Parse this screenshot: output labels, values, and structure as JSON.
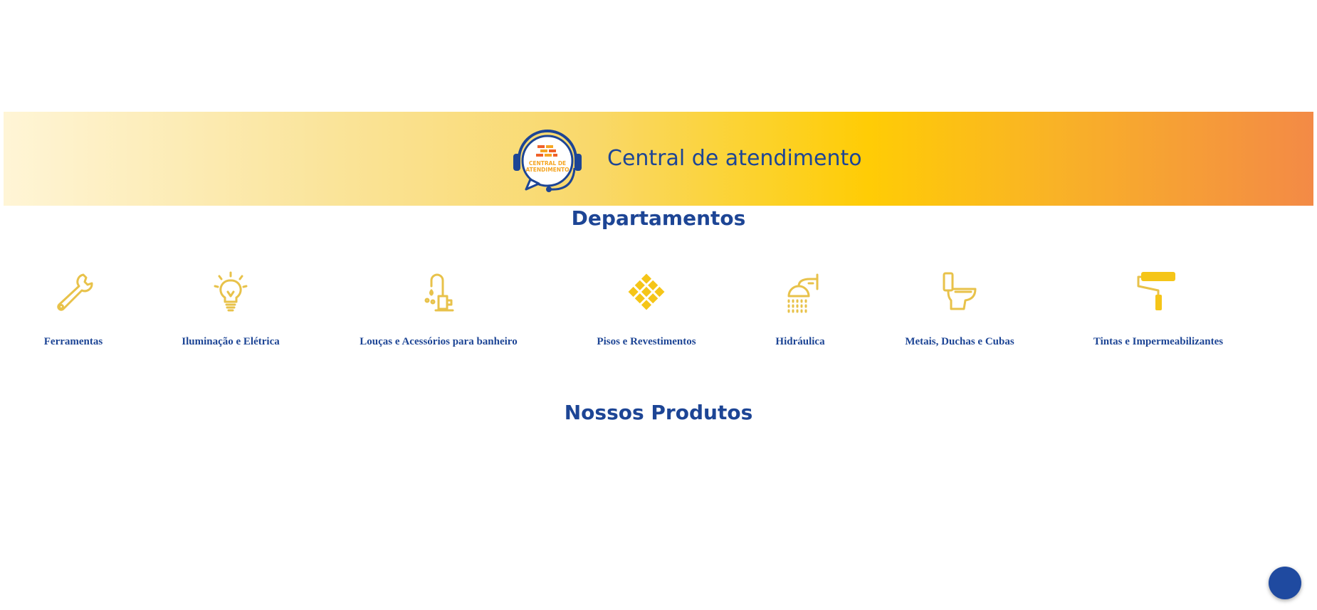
{
  "banner": {
    "title": "Central de atendimento",
    "logo_text_line1": "CENTRAL DE",
    "logo_text_line2": "ATENDIMENTO",
    "gradient_colors": [
      "#fff5d6",
      "#fcd22a",
      "#ffcc05",
      "#f38a46"
    ]
  },
  "departments": {
    "heading": "Departamentos",
    "items": [
      {
        "label": "Ferramentas",
        "icon": "wrench-icon"
      },
      {
        "label": "Iluminação e Elétrica",
        "icon": "lightbulb-icon"
      },
      {
        "label": "Louças e Acessórios para banheiro",
        "icon": "faucet-icon"
      },
      {
        "label": "Pisos e Revestimentos",
        "icon": "tiles-icon"
      },
      {
        "label": "Hidráulica",
        "icon": "shower-icon"
      },
      {
        "label": "Metais, Duchas e Cubas",
        "icon": "toilet-icon"
      },
      {
        "label": "Tintas e Impermeabilizantes",
        "icon": "paint-roller-icon"
      }
    ]
  },
  "products": {
    "heading": "Nossos Produtos"
  },
  "colors": {
    "brand_blue": "#1d4595",
    "accent_yellow": "#f5c518",
    "icon_gold": "#e8c24a"
  }
}
